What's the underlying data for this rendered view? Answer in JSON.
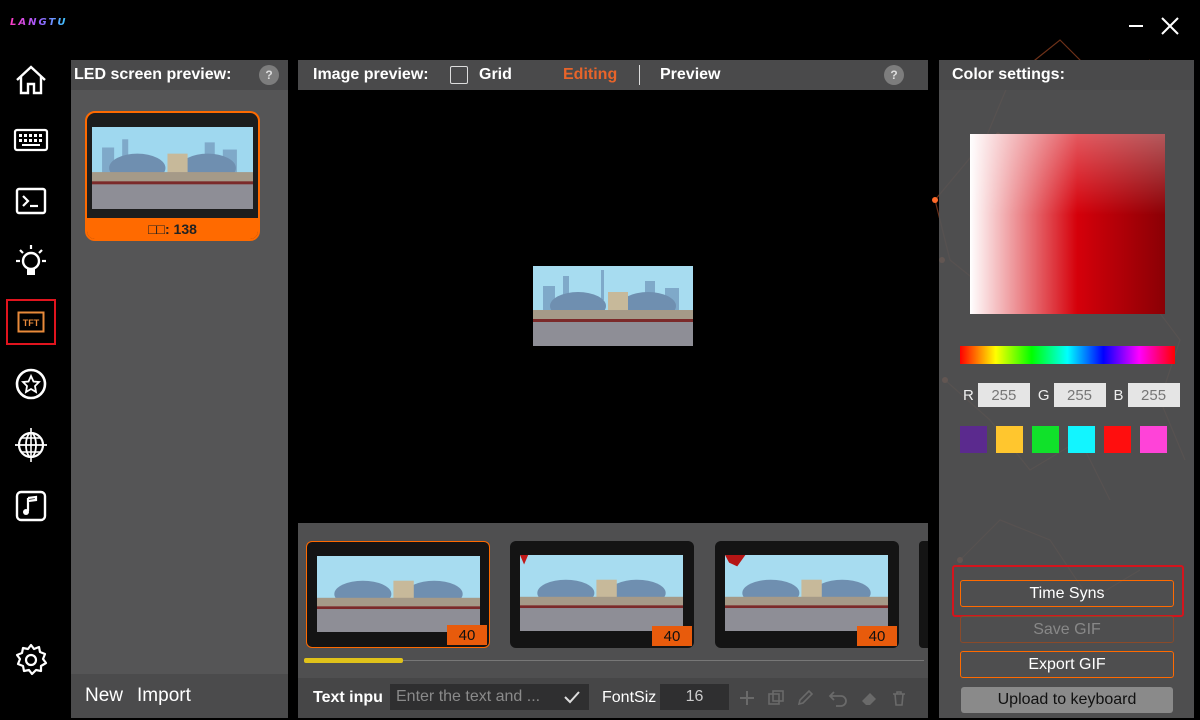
{
  "app": {
    "logo": "LANGTU",
    "minimize_icon": "minimize-icon",
    "close_icon": "close-icon"
  },
  "nav": {
    "items": [
      {
        "icon": "home-icon"
      },
      {
        "icon": "keyboard-icon"
      },
      {
        "icon": "terminal-macro-icon"
      },
      {
        "icon": "lightbulb-icon"
      },
      {
        "icon": "tft-screen-icon",
        "label": "TFT",
        "active": true
      },
      {
        "icon": "star-badge-icon"
      },
      {
        "icon": "globe-icon"
      },
      {
        "icon": "music-note-icon"
      }
    ],
    "settings_icon": "gear-icon"
  },
  "left_panel": {
    "title": "LED screen preview:",
    "help": "?",
    "thumb_count": "□□: 138",
    "new_label": "New",
    "import_label": "Import"
  },
  "mid_panel": {
    "title": "Image preview:",
    "grid_label": "Grid",
    "editing_label": "Editing",
    "preview_label": "Preview",
    "help": "?",
    "frames": [
      {
        "duration": "40"
      },
      {
        "duration": "40"
      },
      {
        "duration": "40"
      }
    ],
    "scroll_progress": 0.16,
    "text_input_label": "Text inpu",
    "text_input_placeholder": "Enter the text and ...",
    "font_size_label": "FontSiz",
    "font_size_value": "16"
  },
  "right_panel": {
    "title": "Color settings:",
    "r_label": "R",
    "r_value": "255",
    "g_label": "G",
    "g_value": "255",
    "b_label": "B",
    "b_value": "255",
    "swatches": [
      "#5b2a8e",
      "#ffc62e",
      "#10e12a",
      "#12f5ff",
      "#ff0e0e",
      "#ff43d8"
    ],
    "time_sync_label": "Time Syns",
    "save_gif_label": "Save GIF",
    "export_gif_label": "Export GIF",
    "upload_label": "Upload to keyboard"
  },
  "colors": {
    "accent": "#ff6a00",
    "highlight_red": "#d4141d",
    "panel_bg": "#555556"
  }
}
